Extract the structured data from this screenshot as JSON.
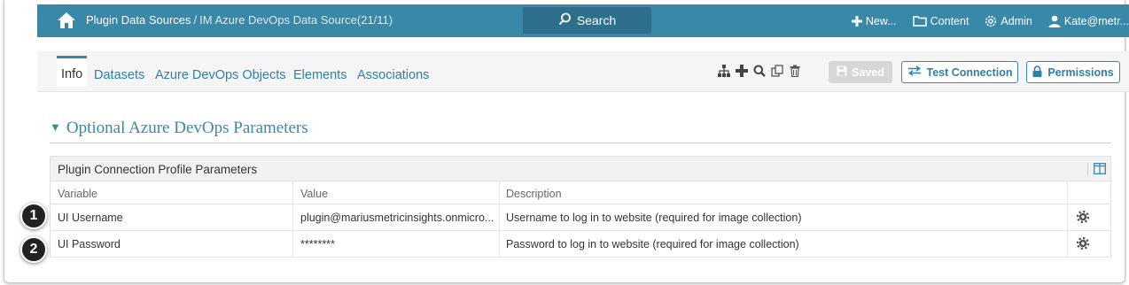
{
  "topbar": {
    "breadcrumb_link": "Plugin Data Sources",
    "breadcrumb_sep": "/",
    "breadcrumb_current": "IM Azure DevOps Data Source(21/11)",
    "search_label": "Search",
    "new_label": "New...",
    "content_label": "Content",
    "admin_label": "Admin",
    "user_label": "Kate@metr..."
  },
  "tabs": [
    {
      "label": "Info",
      "active": true
    },
    {
      "label": "Datasets"
    },
    {
      "label": "Azure DevOps Objects"
    },
    {
      "label": "Elements"
    },
    {
      "label": "Associations"
    }
  ],
  "toolbar": {
    "icons": [
      "hierarchy-icon",
      "plus-icon",
      "search-icon",
      "copy-icon",
      "trash-icon"
    ],
    "saved_label": "Saved",
    "test_connection_label": "Test Connection",
    "permissions_label": "Permissions"
  },
  "section": {
    "title": "Optional Azure DevOps Parameters"
  },
  "panel": {
    "title": "Plugin Connection Profile Parameters",
    "columns": [
      "Variable",
      "Value",
      "Description"
    ],
    "rows": [
      {
        "variable": "UI Username",
        "value": "plugin@mariusmetricinsights.onmicro...",
        "description": "Username to log in to website (required for image collection)"
      },
      {
        "variable": "UI Password",
        "value": "********",
        "description": "Password to log in to website (required for image collection)"
      }
    ]
  },
  "badges": [
    "1",
    "2"
  ],
  "colors": {
    "accent": "#3a88a8",
    "accent_dark": "#2e6f8b",
    "link": "#2f7fa8"
  }
}
